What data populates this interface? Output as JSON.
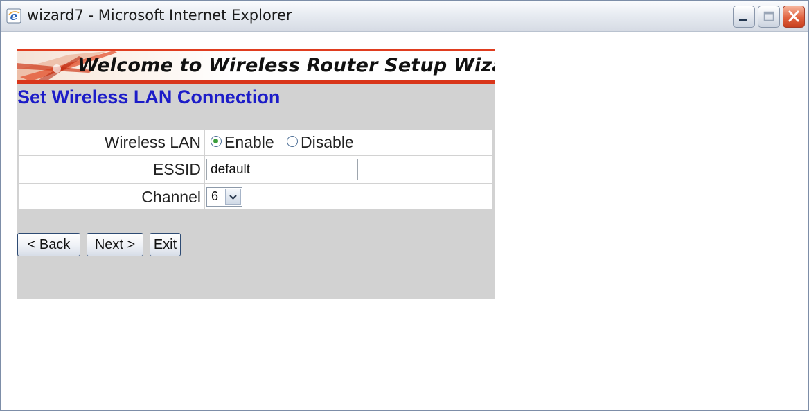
{
  "window": {
    "title": "wizard7 - Microsoft Internet Explorer"
  },
  "banner": {
    "title": "Welcome to Wireless Router Setup Wizard"
  },
  "section": {
    "title": "Set Wireless LAN Connection"
  },
  "form": {
    "wireless_lan": {
      "label": "Wireless LAN",
      "options": [
        "Enable",
        "Disable"
      ],
      "selected": "Enable"
    },
    "essid": {
      "label": "ESSID",
      "value": "default"
    },
    "channel": {
      "label": "Channel",
      "value": "6"
    }
  },
  "buttons": {
    "back": "< Back",
    "next": "Next >",
    "exit": "Exit"
  },
  "colors": {
    "section_title": "#1c1cc8",
    "panel_background": "#d2d2d2",
    "banner_accent": "#e03d1f"
  }
}
